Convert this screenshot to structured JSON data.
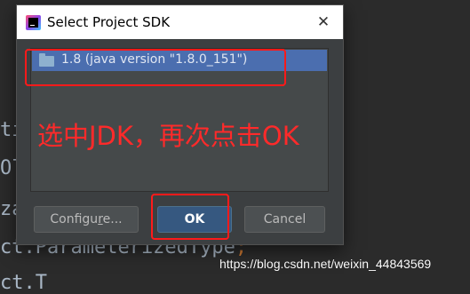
{
  "background_code": {
    "lines": [
      {
        "text": "ti",
        "suffix": ""
      },
      {
        "text": "Ol",
        "suffix": ""
      },
      {
        "text": "za",
        "suffix": ""
      },
      {
        "text": "ct.ParameterizedType",
        "suffix": ";"
      },
      {
        "text": "ct.T",
        "suffix": ""
      }
    ]
  },
  "dialog": {
    "title": "Select Project SDK",
    "close_glyph": "✕",
    "sdk_items": [
      {
        "label": "1.8 (java version \"1.8.0_151\")",
        "selected": true
      }
    ],
    "buttons": {
      "configure_prefix": "Configu",
      "configure_mnemonic": "r",
      "configure_suffix": "e...",
      "ok": "OK",
      "cancel": "Cancel"
    }
  },
  "annotation": {
    "text": "选中JDK，再次点击OK",
    "color": "#ff2a2a"
  },
  "watermark": "https://blog.csdn.net/weixin_44843569",
  "colors": {
    "dialog_bg": "#3c3f41",
    "selection": "#4b6eaf",
    "ok_button": "#365880",
    "highlight_border": "#ff1a1a"
  },
  "icons": {
    "app": "intellij-idea-icon",
    "sdk": "folder-icon",
    "close": "close-icon"
  }
}
